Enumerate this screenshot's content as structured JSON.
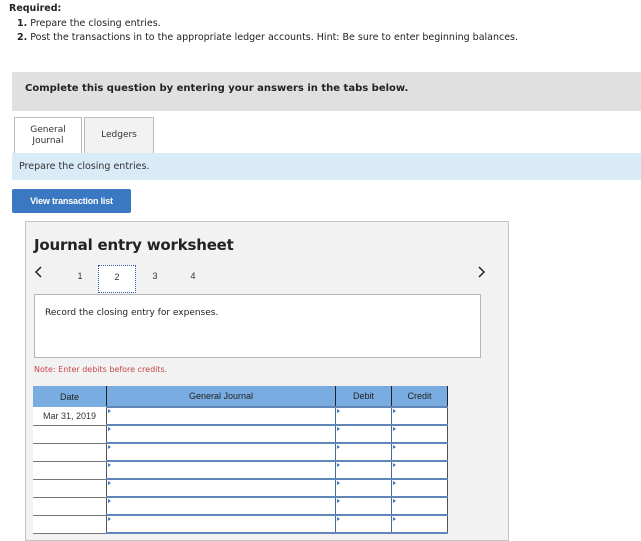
{
  "required": {
    "title": "Required:",
    "items": [
      {
        "num": "1.",
        "text": "Prepare the closing entries."
      },
      {
        "num": "2.",
        "text": "Post the transactions in to the appropriate ledger accounts. Hint: Be sure to enter beginning balances."
      }
    ]
  },
  "banner": {
    "text": "Complete this question by entering your answers in the tabs below."
  },
  "tabs": [
    {
      "label_line1": "General",
      "label_line2": "Journal",
      "active": true
    },
    {
      "label": "Ledgers",
      "active": false
    }
  ],
  "info": {
    "text": "Prepare the closing entries."
  },
  "button": {
    "label": "View transaction list"
  },
  "worksheet": {
    "title": "Journal entry worksheet",
    "prev_icon": "chevron-left-icon",
    "next_icon": "chevron-right-icon",
    "pages": [
      "1",
      "2",
      "3",
      "4"
    ],
    "current_page": "2",
    "prompt": "Record the closing entry for expenses.",
    "note": "Note: Enter debits before credits.",
    "table": {
      "headers": [
        "Date",
        "General Journal",
        "Debit",
        "Credit"
      ],
      "rows": [
        {
          "date": "Mar 31, 2019",
          "account": "",
          "debit": "",
          "credit": ""
        },
        {
          "date": "",
          "account": "",
          "debit": "",
          "credit": ""
        },
        {
          "date": "",
          "account": "",
          "debit": "",
          "credit": ""
        },
        {
          "date": "",
          "account": "",
          "debit": "",
          "credit": ""
        },
        {
          "date": "",
          "account": "",
          "debit": "",
          "credit": ""
        },
        {
          "date": "",
          "account": "",
          "debit": "",
          "credit": ""
        },
        {
          "date": "",
          "account": "",
          "debit": "",
          "credit": ""
        }
      ]
    }
  },
  "colors": {
    "button_bg": "#3b78c2",
    "table_header_bg": "#79ace0",
    "info_strip_bg": "#d9ebf7",
    "banner_bg": "#e0e0e0",
    "note_text": "#c9444a"
  }
}
